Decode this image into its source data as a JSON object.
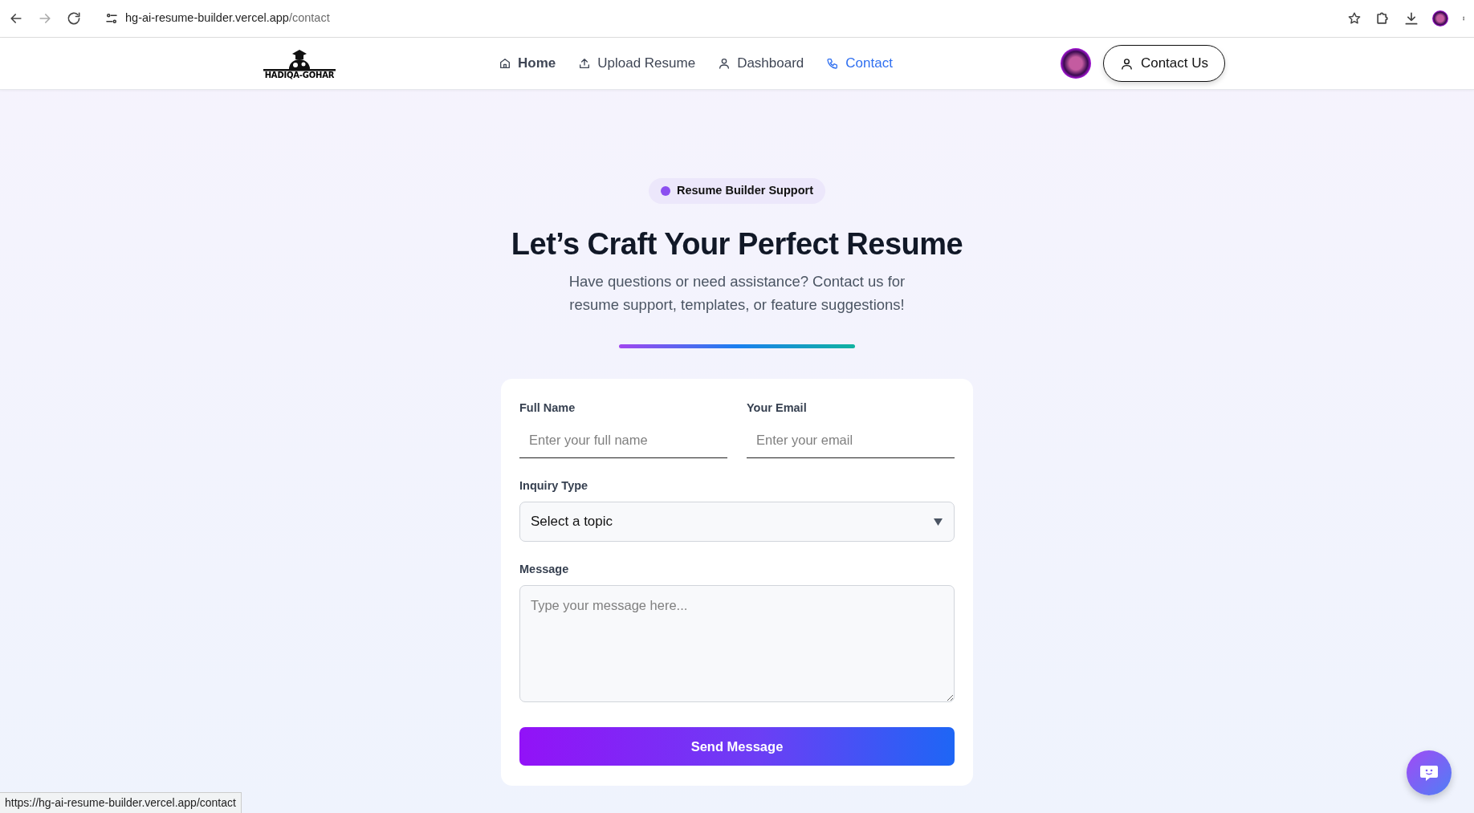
{
  "browser": {
    "url_host": "hg-ai-resume-builder.vercel.app",
    "url_path": "/contact"
  },
  "navbar": {
    "logo_text": "HADIQA-GOHAR",
    "links": [
      {
        "label": "Home",
        "selected": false,
        "bold": true
      },
      {
        "label": "Upload Resume",
        "selected": false,
        "bold": false
      },
      {
        "label": "Dashboard",
        "selected": false,
        "bold": false
      },
      {
        "label": "Contact",
        "selected": true,
        "bold": false
      }
    ],
    "button": "Contact Us"
  },
  "hero": {
    "badge": "Resume Builder Support",
    "title": "Let’s Craft Your Perfect Resume",
    "subtitle": "Have questions or need assistance? Contact us for resume support, templates, or feature suggestions!"
  },
  "form": {
    "fields": [
      {
        "kind": "line",
        "label": "Full Name",
        "placeholder": "Enter your full name"
      },
      {
        "kind": "line",
        "label": "Your Email",
        "placeholder": "Enter your email"
      },
      {
        "kind": "select",
        "label": "Inquiry Type",
        "value": "Select a topic"
      },
      {
        "kind": "textarea",
        "label": "Message",
        "placeholder": "Type your message here..."
      }
    ],
    "submit": "Send Message"
  },
  "status_bar": {
    "url": "https://hg-ai-resume-builder.vercel.app/contact"
  }
}
